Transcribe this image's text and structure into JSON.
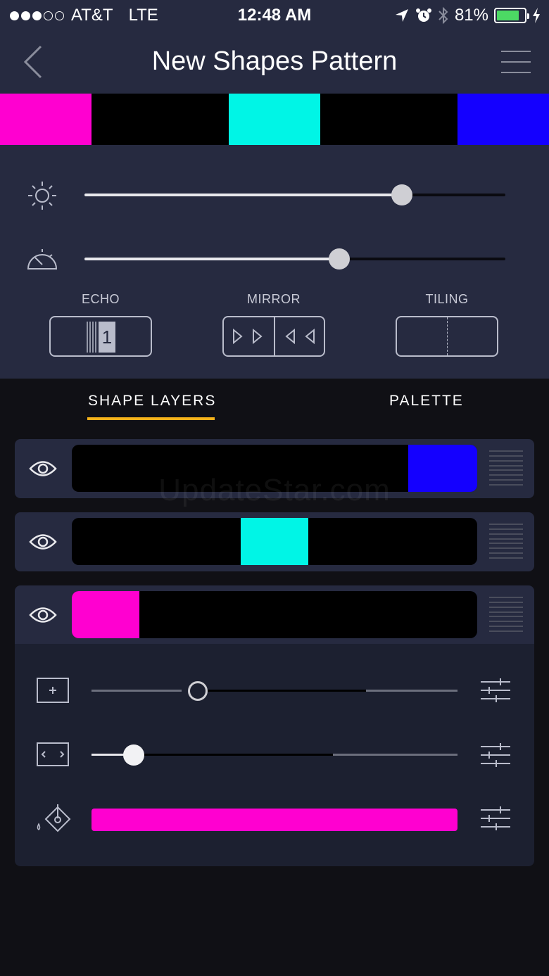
{
  "status_bar": {
    "carrier": "AT&T",
    "network": "LTE",
    "time": "12:48 AM",
    "battery_percent": "81%",
    "battery_level": 0.81,
    "signal_bars_filled": 3,
    "signal_bars_total": 5
  },
  "header": {
    "title": "New Shapes Pattern",
    "back_icon": "chevron-left-icon",
    "menu_icon": "hamburger-menu-icon"
  },
  "pattern_strip": {
    "colors": [
      "#ff00d0",
      "#000000",
      "#00f5e6",
      "#000000",
      "#1400ff"
    ]
  },
  "controls": {
    "brightness": {
      "icon": "sun-icon",
      "value": 0.755
    },
    "speed": {
      "icon": "speedometer-icon",
      "value": 0.605
    },
    "modes": [
      {
        "label": "ECHO",
        "value": "1"
      },
      {
        "label": "MIRROR"
      },
      {
        "label": "TILING"
      }
    ]
  },
  "tabs": [
    {
      "label": "SHAPE LAYERS",
      "active": true
    },
    {
      "label": "PALETTE",
      "active": false
    }
  ],
  "layers": [
    {
      "color": "#1400ff",
      "start": 0.83,
      "end": 1.0
    },
    {
      "color": "#00f5e6",
      "start": 0.417,
      "end": 0.583
    },
    {
      "color": "#ff00d0",
      "start": 0.0,
      "end": 0.167
    }
  ],
  "layer_properties": {
    "size": {
      "icon": "size-box-icon",
      "value": 0.29
    },
    "position": {
      "icon": "width-box-icon",
      "value": 0.116
    },
    "color": {
      "icon": "paint-bucket-icon",
      "value": "#ff00d0"
    }
  },
  "watermark": "UpdateStar.com",
  "colors": {
    "panel": "#262a40",
    "background": "#101015",
    "accent": "#f5b21b"
  }
}
